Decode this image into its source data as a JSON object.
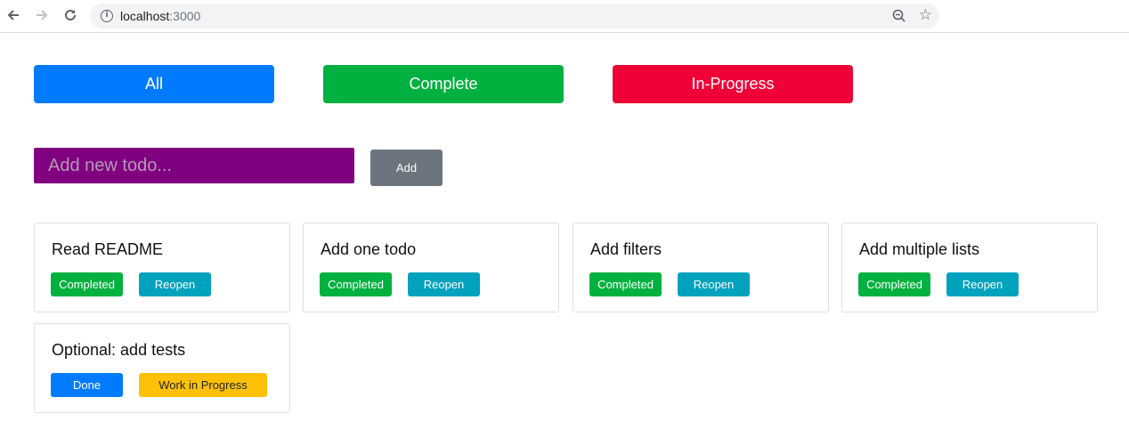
{
  "browser": {
    "url_host": "localhost",
    "url_port": ":3000",
    "back_icon": "arrow-left-icon",
    "forward_icon": "arrow-right-icon",
    "reload_icon": "reload-icon",
    "info_icon": "info-icon",
    "zoom_icon": "zoom-out-icon",
    "star_icon": "star-icon"
  },
  "filters": {
    "all_label": "All",
    "complete_label": "Complete",
    "inprogress_label": "In-Progress",
    "colors": {
      "all": "#007bff",
      "complete": "#00b13f",
      "inprogress": "#ef0036"
    }
  },
  "add_todo": {
    "placeholder": "Add new todo...",
    "value": "",
    "button_label": "Add",
    "input_color": "#800080"
  },
  "todos": [
    {
      "title": "Read README",
      "btn1": "Completed",
      "btn2": "Reopen"
    },
    {
      "title": "Add one todo",
      "btn1": "Completed",
      "btn2": "Reopen"
    },
    {
      "title": "Add filters",
      "btn1": "Completed",
      "btn2": "Reopen"
    },
    {
      "title": "Add multiple lists",
      "btn1": "Completed",
      "btn2": "Reopen"
    },
    {
      "title": "Optional: add tests",
      "btn1": "Done",
      "btn2": "Work in Progress"
    }
  ]
}
